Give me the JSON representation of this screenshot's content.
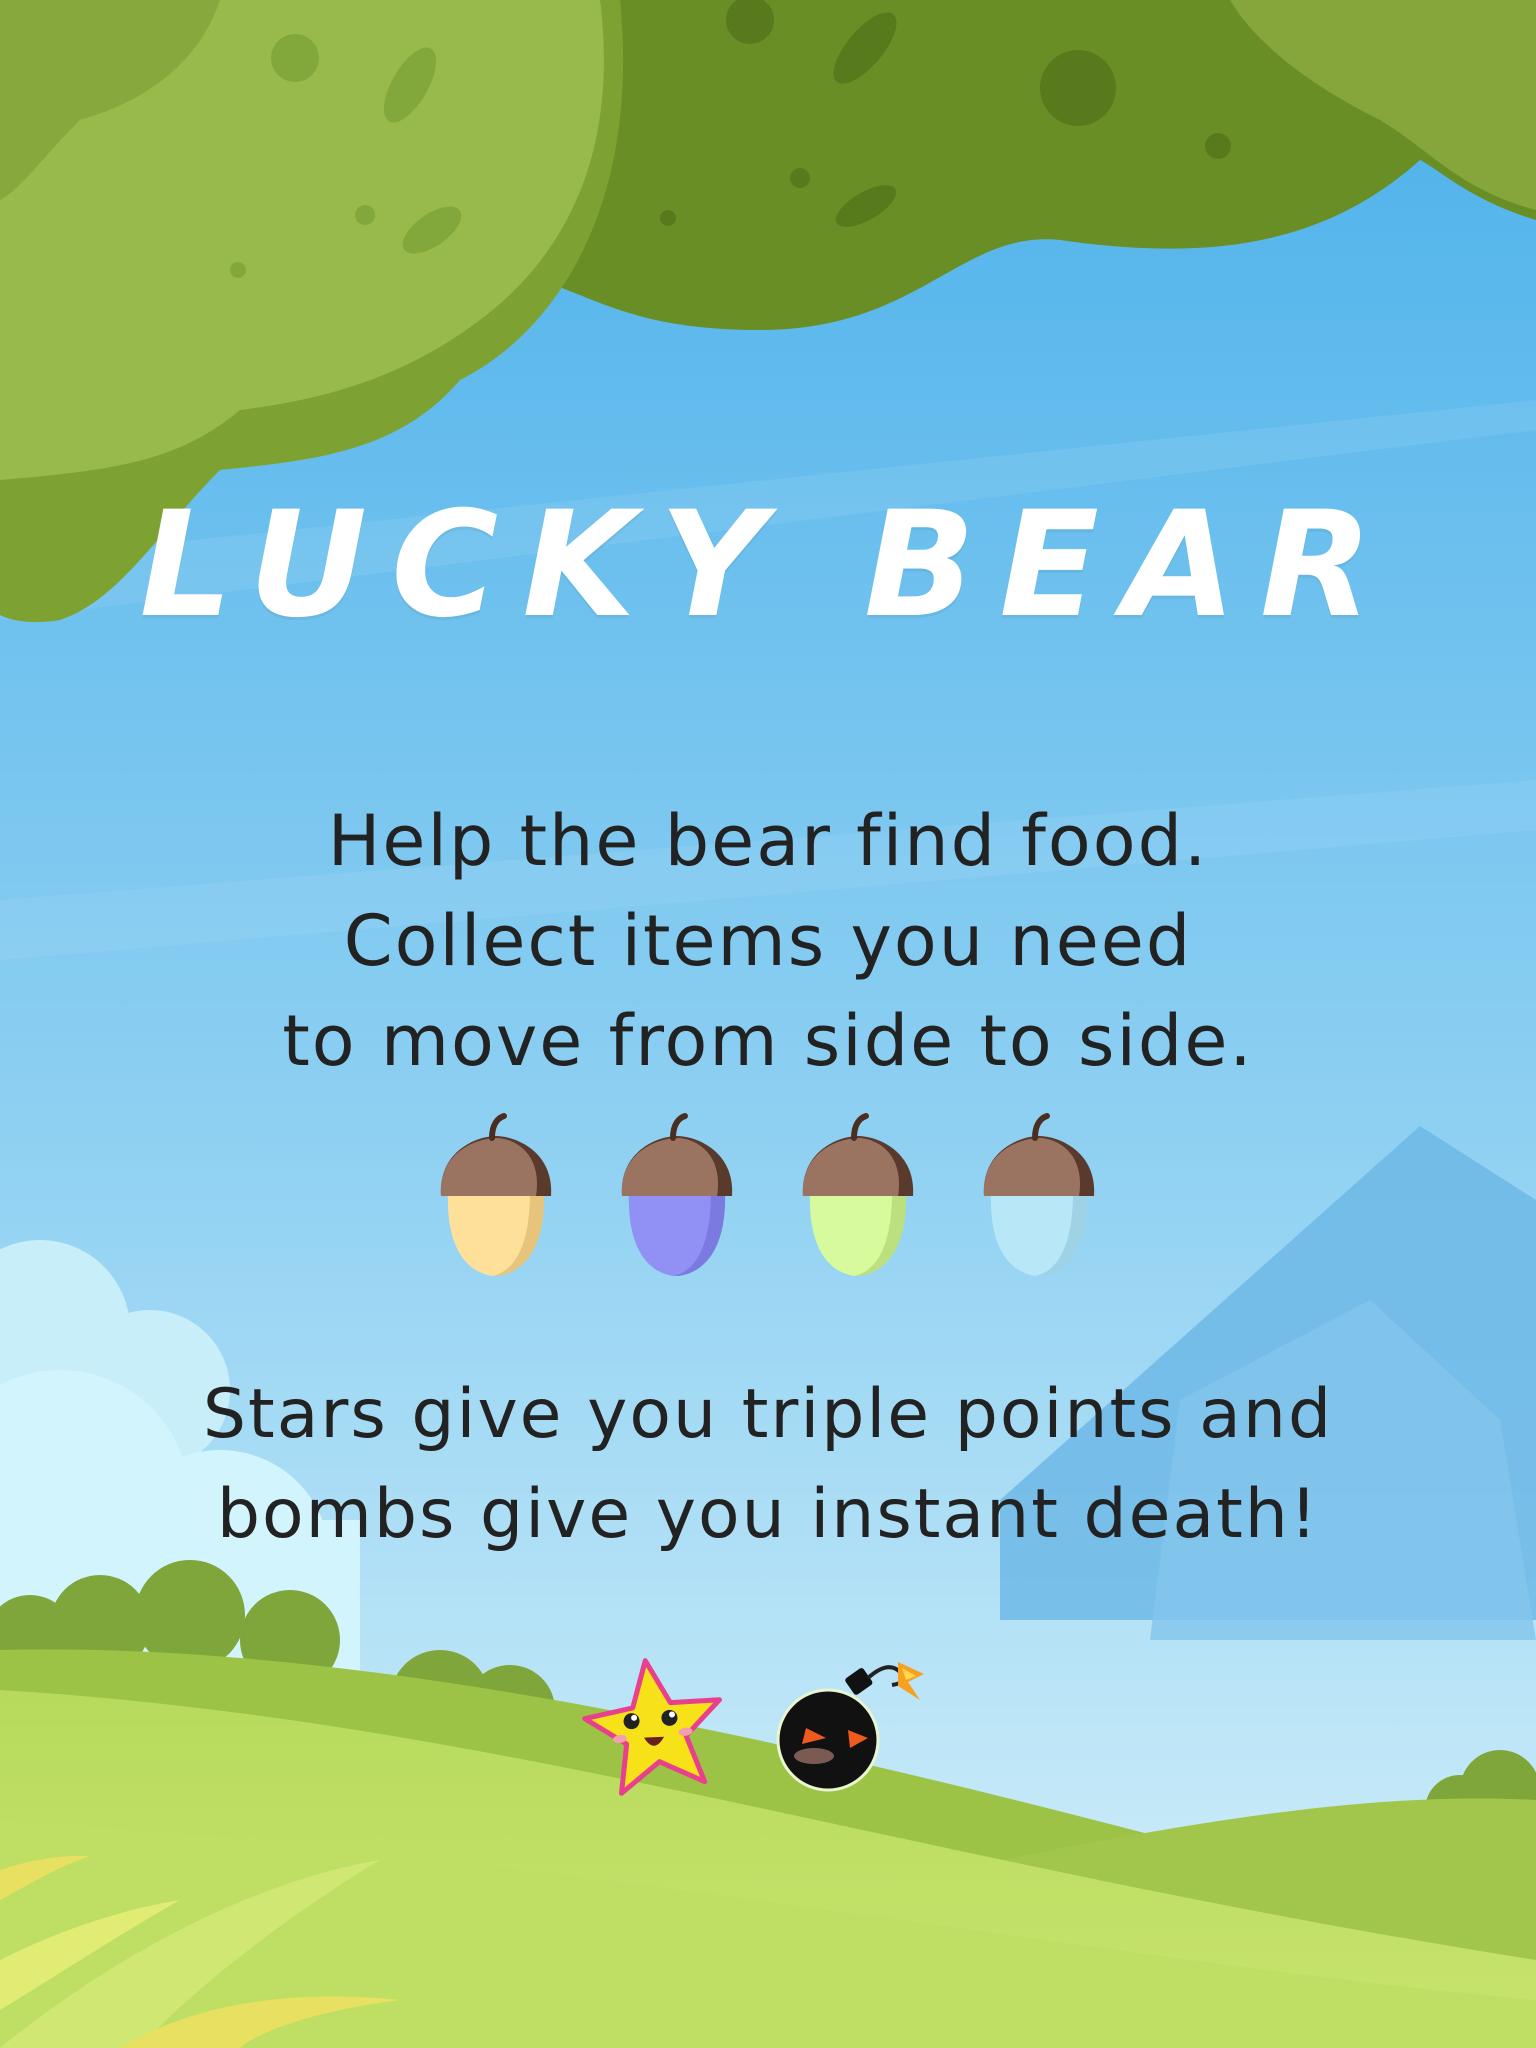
{
  "title": "LUCKY BEAR",
  "instructions": {
    "line1": "Help the bear find food.",
    "line2": "Collect items you need",
    "line3": "to move from side to side.",
    "line4": "Stars give you triple points and",
    "line5": "bombs give you instant death!"
  },
  "acorns": [
    {
      "name": "acorn-yellow-icon",
      "body_color": "#FFE09A",
      "shade_color": "#E6C47C"
    },
    {
      "name": "acorn-purple-icon",
      "body_color": "#9090F5",
      "shade_color": "#7A7AE0"
    },
    {
      "name": "acorn-green-icon",
      "body_color": "#D6FA9C",
      "shade_color": "#BCE080"
    },
    {
      "name": "acorn-blue-icon",
      "body_color": "#B8E8F8",
      "shade_color": "#9ED2E4"
    }
  ],
  "colors": {
    "sky_top": "#4FB3EC",
    "sky_bottom": "#D4F0FA",
    "foliage_light": "#97BA48",
    "foliage_dark": "#6E9228",
    "grass": "#C2E06A",
    "acorn_cap": "#9A7460"
  },
  "specials": [
    "star-icon",
    "bomb-icon"
  ]
}
